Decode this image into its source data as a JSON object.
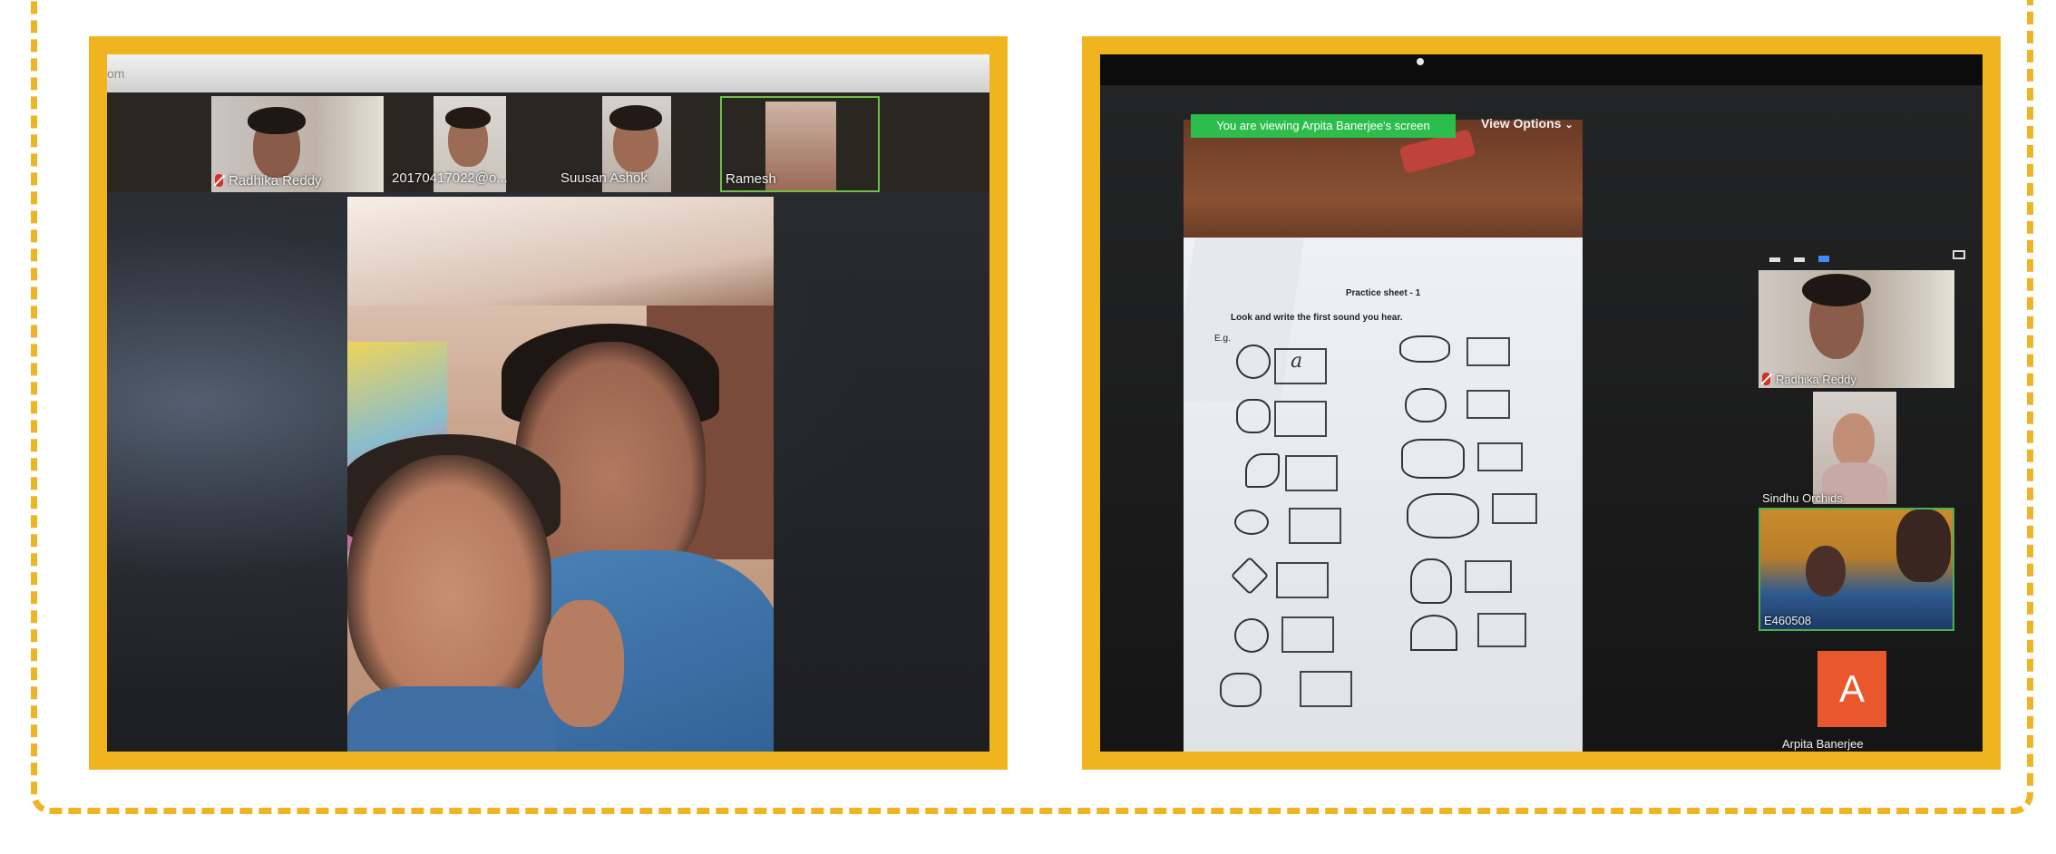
{
  "left_photo": {
    "browser_url_fragment": "om",
    "participants": [
      {
        "name": "Radhika Reddy",
        "muted": true
      },
      {
        "name": "20170417022@o...",
        "muted": false
      },
      {
        "name": "Suusan Ashok",
        "muted": false
      },
      {
        "name": "Ramesh",
        "muted": false,
        "active_speaker": true
      }
    ]
  },
  "right_photo": {
    "share_banner": "You are viewing Arpita Banerjee's screen",
    "view_options_label": "View Options",
    "view_options_icon": "chevron-down-icon",
    "worksheet": {
      "title": "Practice sheet - 1",
      "instruction": "Look and write the first sound you hear.",
      "example_label": "E.g.",
      "example_answer": "a"
    },
    "side_participants": [
      {
        "name": "Radhika Reddy",
        "muted": true
      },
      {
        "name": "Sindhu Orchids",
        "muted": false
      },
      {
        "name": "E460508",
        "muted": false,
        "active_speaker": true
      }
    ],
    "avatar": {
      "initial": "A",
      "name": "Arpita Banerjee",
      "color": "#E8582C"
    }
  },
  "colors": {
    "frame": "#F0B51E",
    "dashed_border": "#EFB423",
    "share_banner": "#2dbd4d",
    "active_border": "#4caf50"
  }
}
